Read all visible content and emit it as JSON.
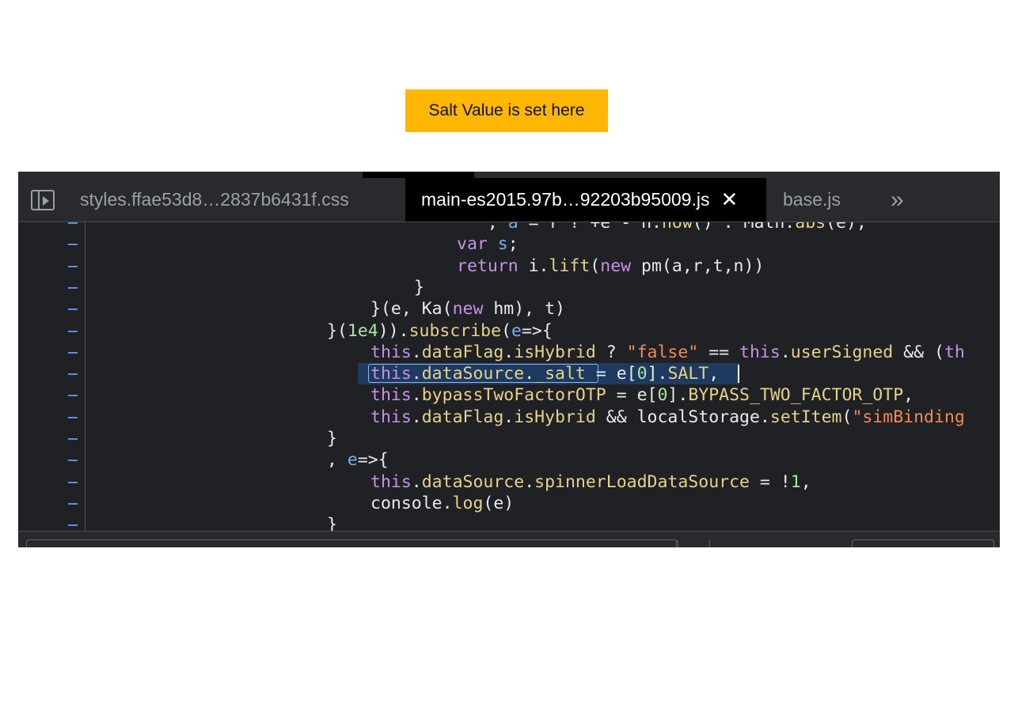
{
  "callout": {
    "text": "Salt Value is set here",
    "color": "#ffb703"
  },
  "tabs": [
    {
      "label": "styles.ffae53d8…2837b6431f.css",
      "active": false
    },
    {
      "label": "main-es2015.97b…92203b95009.js",
      "active": true,
      "close": "✕"
    },
    {
      "label": "base.js",
      "active": false
    }
  ],
  "more_tabs_icon": "»",
  "gutter_marker": "–",
  "code_lines": [
    [
      {
        "c": "t",
        "x": "                    , "
      },
      {
        "c": "v",
        "x": "a"
      },
      {
        "c": "t",
        "x": " = r ? +e - n."
      },
      {
        "c": "f",
        "x": "now"
      },
      {
        "c": "t",
        "x": "() : Math."
      },
      {
        "c": "f",
        "x": "abs"
      },
      {
        "c": "t",
        "x": "(e);"
      }
    ],
    [
      {
        "c": "k",
        "x": "var"
      },
      {
        "c": "t",
        "x": " "
      },
      {
        "c": "v",
        "x": "s"
      },
      {
        "c": "t",
        "x": ";"
      }
    ],
    [
      {
        "c": "k",
        "x": "return"
      },
      {
        "c": "t",
        "x": " i."
      },
      {
        "c": "f",
        "x": "lift"
      },
      {
        "c": "t",
        "x": "("
      },
      {
        "c": "k",
        "x": "new"
      },
      {
        "c": "t",
        "x": " pm(a,r,t,n))"
      }
    ],
    [
      {
        "c": "t",
        "x": "}"
      }
    ],
    [
      {
        "c": "t",
        "x": "}(e, Ka("
      },
      {
        "c": "k",
        "x": "new"
      },
      {
        "c": "t",
        "x": " hm), t)"
      }
    ],
    [
      {
        "c": "t",
        "x": "}("
      },
      {
        "c": "n",
        "x": "1e4"
      },
      {
        "c": "t",
        "x": "))."
      },
      {
        "c": "f",
        "x": "subscribe"
      },
      {
        "c": "t",
        "x": "("
      },
      {
        "c": "v",
        "x": "e"
      },
      {
        "c": "t",
        "x": "=>{"
      }
    ],
    [
      {
        "c": "k",
        "x": "this"
      },
      {
        "c": "t",
        "x": "."
      },
      {
        "c": "f",
        "x": "dataFlag"
      },
      {
        "c": "t",
        "x": "."
      },
      {
        "c": "f",
        "x": "isHybrid"
      },
      {
        "c": "t",
        "x": " ? "
      },
      {
        "c": "s",
        "x": "\"false\""
      },
      {
        "c": "t",
        "x": " == "
      },
      {
        "c": "k",
        "x": "this"
      },
      {
        "c": "t",
        "x": "."
      },
      {
        "c": "f",
        "x": "userSigned"
      },
      {
        "c": "t",
        "x": " && ("
      },
      {
        "c": "k",
        "x": "th"
      }
    ],
    [
      {
        "c": "k",
        "x": "this"
      },
      {
        "c": "t",
        "x": "."
      },
      {
        "c": "f",
        "x": "dataSource"
      },
      {
        "c": "t",
        "x": "."
      },
      {
        "c": "f",
        "x": "_salt"
      },
      {
        "c": "t",
        "x": " = e["
      },
      {
        "c": "n",
        "x": "0"
      },
      {
        "c": "t",
        "x": "]."
      },
      {
        "c": "f",
        "x": "SALT"
      },
      {
        "c": "t",
        "x": ","
      }
    ],
    [
      {
        "c": "k",
        "x": "this"
      },
      {
        "c": "t",
        "x": "."
      },
      {
        "c": "f",
        "x": "bypassTwoFactorOTP"
      },
      {
        "c": "t",
        "x": " = e["
      },
      {
        "c": "n",
        "x": "0"
      },
      {
        "c": "t",
        "x": "]."
      },
      {
        "c": "f",
        "x": "BYPASS_TWO_FACTOR_OTP"
      },
      {
        "c": "t",
        "x": ","
      }
    ],
    [
      {
        "c": "k",
        "x": "this"
      },
      {
        "c": "t",
        "x": "."
      },
      {
        "c": "f",
        "x": "dataFlag"
      },
      {
        "c": "t",
        "x": "."
      },
      {
        "c": "f",
        "x": "isHybrid"
      },
      {
        "c": "t",
        "x": " && localStorage."
      },
      {
        "c": "f",
        "x": "setItem"
      },
      {
        "c": "t",
        "x": "("
      },
      {
        "c": "s",
        "x": "\"simBinding"
      }
    ],
    [
      {
        "c": "t",
        "x": "}"
      }
    ],
    [
      {
        "c": "t",
        "x": ", "
      },
      {
        "c": "v",
        "x": "e"
      },
      {
        "c": "t",
        "x": "=>{"
      }
    ],
    [
      {
        "c": "k",
        "x": "this"
      },
      {
        "c": "t",
        "x": "."
      },
      {
        "c": "f",
        "x": "dataSource"
      },
      {
        "c": "t",
        "x": "."
      },
      {
        "c": "f",
        "x": "spinnerLoadDataSource"
      },
      {
        "c": "t",
        "x": " = !"
      },
      {
        "c": "n",
        "x": "1"
      },
      {
        "c": "t",
        "x": ","
      }
    ],
    [
      {
        "c": "t",
        "x": "console."
      },
      {
        "c": "f",
        "x": "log"
      },
      {
        "c": "t",
        "x": "(e)"
      }
    ],
    [
      {
        "c": "t",
        "x": "}"
      }
    ]
  ]
}
